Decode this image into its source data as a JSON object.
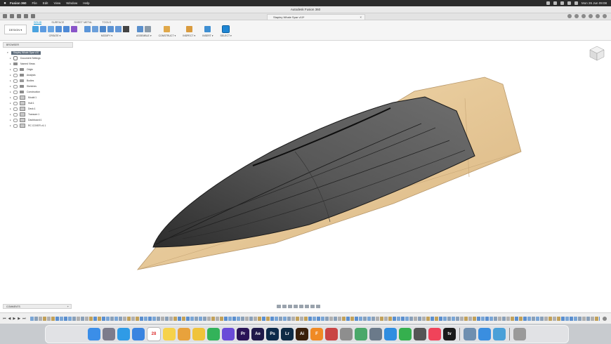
{
  "menubar": {
    "apple": "",
    "items": [
      "Fusion 360",
      "File",
      "Edit",
      "View",
      "Window",
      "Help"
    ],
    "clock": "Mon 26 Jun 09:08"
  },
  "window": {
    "title": "Autodesk Fusion 360"
  },
  "doc_tab": {
    "label": "Stapley Whale Spar v10*",
    "close": "×"
  },
  "ribbon": {
    "workspace": "DESIGN ▾",
    "tabs": [
      "SOLID",
      "SURFACE",
      "SHEET METAL",
      "TOOLS"
    ],
    "groups": [
      "CREATE ▾",
      "MODIFY ▾",
      "ASSEMBLE ▾",
      "CONSTRUCT ▾",
      "INSPECT ▾",
      "INSERT ▾",
      "SELECT ▾"
    ]
  },
  "browser": {
    "header": "BROWSER",
    "root": "Stapley Whale Spar v10",
    "items": [
      {
        "label": "Document Settings",
        "type": "gear"
      },
      {
        "label": "Named Views",
        "type": "folder"
      },
      {
        "label": "Origin",
        "type": "folder"
      },
      {
        "label": "Analysis",
        "type": "folder"
      },
      {
        "label": "Bodies",
        "type": "body"
      },
      {
        "label": "Sketches",
        "type": "folder"
      },
      {
        "label": "Construction",
        "type": "folder"
      },
      {
        "label": "Mould:1",
        "type": "sketch"
      },
      {
        "label": "Hull:1",
        "type": "sketch"
      },
      {
        "label": "Deck:1",
        "type": "sketch"
      },
      {
        "label": "Transom:1",
        "type": "sketch"
      },
      {
        "label": "Dashboard:1",
        "type": "sketch"
      },
      {
        "label": "RC COVER v1:1",
        "type": "sketch"
      }
    ]
  },
  "comments": {
    "label": "COMMENTS",
    "plus": "+"
  },
  "timeline": {
    "controls": [
      "⏮",
      "◀",
      "▶",
      "▶",
      "⏭"
    ]
  },
  "dock": {
    "apps": [
      {
        "name": "finder",
        "label": "",
        "color": "#3b8ee8"
      },
      {
        "name": "launchpad",
        "label": "",
        "color": "#7c7c8c"
      },
      {
        "name": "safari",
        "label": "",
        "color": "#2f9be6"
      },
      {
        "name": "mail",
        "label": "",
        "color": "#3a84e0"
      },
      {
        "name": "calendar",
        "label": "28",
        "color": "#ffffff"
      },
      {
        "name": "notes",
        "label": "",
        "color": "#f6d24b"
      },
      {
        "name": "photos",
        "label": "",
        "color": "#e8a23c"
      },
      {
        "name": "pencil",
        "label": "",
        "color": "#f0c33a"
      },
      {
        "name": "numbers",
        "label": "",
        "color": "#33b35a"
      },
      {
        "name": "imovie",
        "label": "",
        "color": "#6a4bd8"
      },
      {
        "name": "premiere",
        "label": "Pr",
        "color": "#2a1457"
      },
      {
        "name": "after-effects",
        "label": "Ae",
        "color": "#1f1a4a"
      },
      {
        "name": "photoshop",
        "label": "Ps",
        "color": "#0c2a4a"
      },
      {
        "name": "lightroom",
        "label": "Lr",
        "color": "#0f2b45"
      },
      {
        "name": "illustrator",
        "label": "Ai",
        "color": "#3a1f0a"
      },
      {
        "name": "fusion-360",
        "label": "F",
        "color": "#f08a24"
      },
      {
        "name": "app-red",
        "label": "",
        "color": "#c94545"
      },
      {
        "name": "app-box",
        "label": "",
        "color": "#8e8e8e"
      },
      {
        "name": "maps",
        "label": "",
        "color": "#4aa86a"
      },
      {
        "name": "settings-cog",
        "label": "",
        "color": "#6b7a8a"
      },
      {
        "name": "app-store",
        "label": "",
        "color": "#2f8de0"
      },
      {
        "name": "facetime",
        "label": "",
        "color": "#35b04e"
      },
      {
        "name": "compass",
        "label": "",
        "color": "#555555"
      },
      {
        "name": "music",
        "label": "",
        "color": "#f0435a"
      },
      {
        "name": "apple-tv",
        "label": "tv",
        "color": "#1a1a1a"
      },
      {
        "name": "preview",
        "label": "",
        "color": "#6f8fb0"
      },
      {
        "name": "app-store-2",
        "label": "",
        "color": "#3a8ee0"
      },
      {
        "name": "screen-app",
        "label": "",
        "color": "#4aa0d8"
      },
      {
        "name": "trash",
        "label": "",
        "color": "#9a9a9a"
      }
    ]
  },
  "colors": {
    "accent": "#0696d7",
    "wood": "#e5c99a",
    "hull": "#4a4a4a"
  }
}
